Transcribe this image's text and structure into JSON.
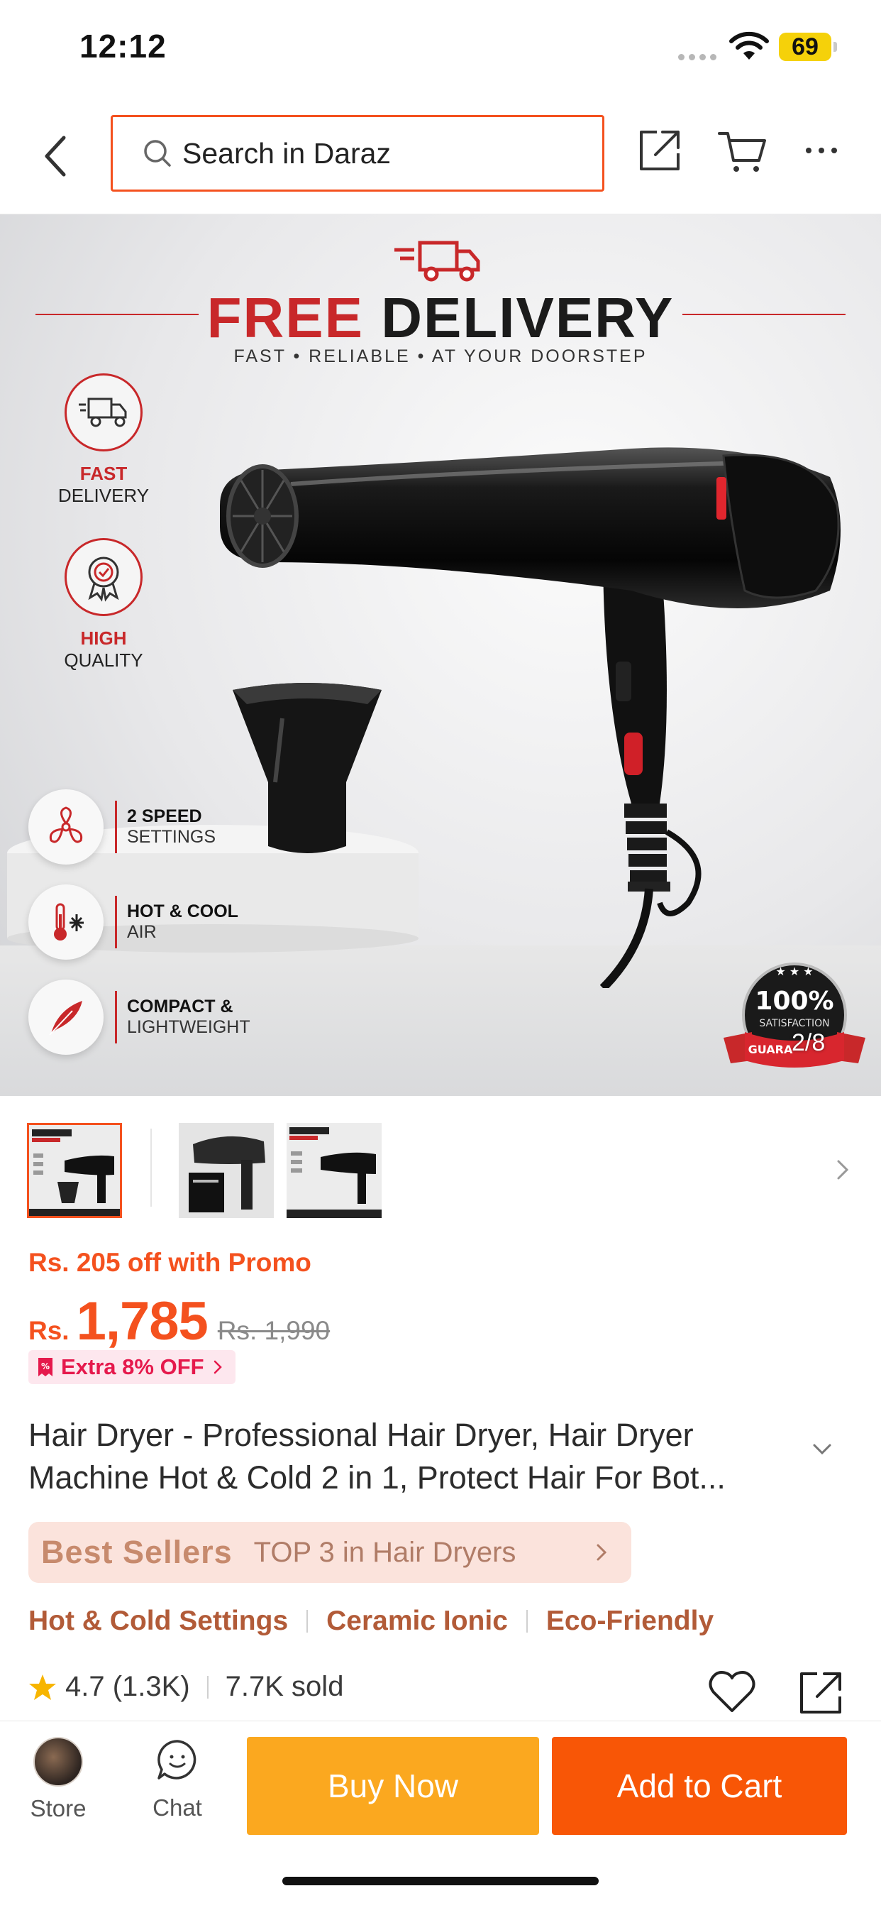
{
  "status_bar": {
    "time": "12:12",
    "battery": "69"
  },
  "search": {
    "placeholder": "Search in Daraz"
  },
  "banner": {
    "headline_red": "FREE",
    "headline_dark": "DELIVERY",
    "subline": "FAST • RELIABLE • AT YOUR DOORSTEP",
    "badges": [
      {
        "red": "FAST",
        "dark": "DELIVERY"
      },
      {
        "red": "HIGH",
        "dark": "QUALITY"
      }
    ],
    "features": [
      {
        "l1": "2 SPEED",
        "l2": "SETTINGS"
      },
      {
        "l1": "HOT & COOL",
        "l2": "AIR"
      },
      {
        "l1": "COMPACT &",
        "l2": "LIGHTWEIGHT"
      }
    ],
    "seal": {
      "big": "100%",
      "small": "SATISFACTION",
      "ribbon": "GUARA"
    },
    "image_counter": "2/8"
  },
  "thumbs_count": 3,
  "price": {
    "promo": "Rs. 205 off with Promo",
    "currency": "Rs.",
    "value": "1,785",
    "original": "Rs. 1,990",
    "extra": "Extra 8% OFF"
  },
  "product_title": "Hair Dryer - Professional Hair Dryer, Hair Dryer Machine Hot & Cold 2 in 1, Protect Hair For Bot...",
  "best_sellers": {
    "label": "Best Sellers",
    "rank": "TOP 3 in Hair Dryers"
  },
  "tags": [
    "Hot & Cold Settings",
    "Ceramic Ionic",
    "Eco-Friendly"
  ],
  "rating": {
    "value": "4.7 (1.3K)",
    "sold": "7.7K sold"
  },
  "bottom_bar": {
    "store_label": "Store",
    "chat_label": "Chat",
    "buy_now": "Buy Now",
    "add_to_cart": "Add to Cart"
  },
  "colors": {
    "accent": "#f85606",
    "buy_now": "#fba81f",
    "promo": "#f4511e",
    "brand_red": "#c8282a"
  }
}
